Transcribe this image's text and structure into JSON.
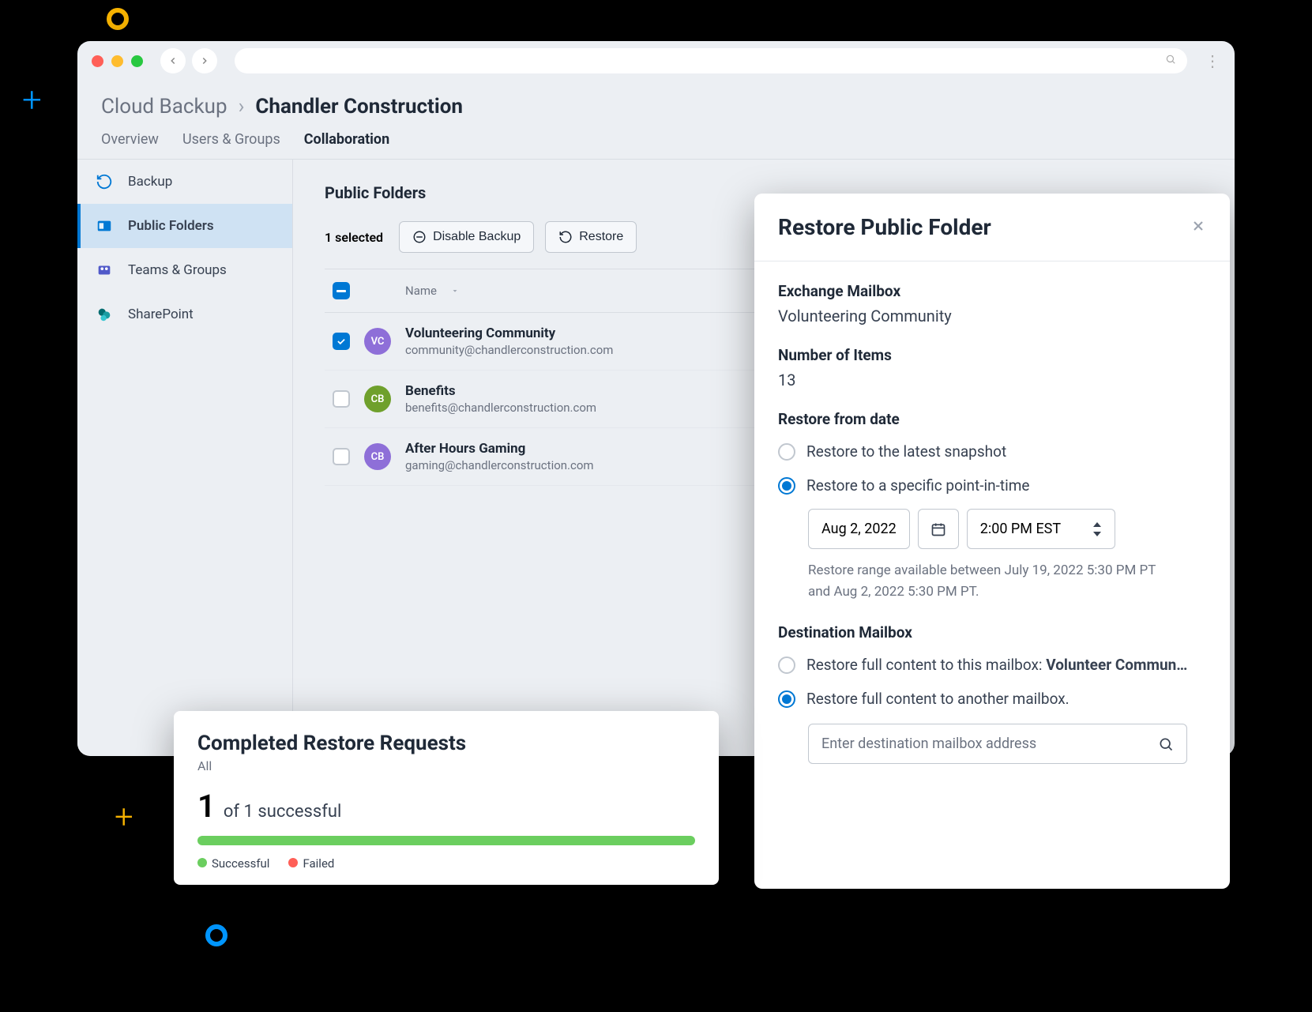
{
  "breadcrumb": {
    "root": "Cloud Backup",
    "current": "Chandler Construction"
  },
  "tabs": [
    "Overview",
    "Users & Groups",
    "Collaboration"
  ],
  "active_tab": "Collaboration",
  "sidebar": {
    "items": [
      {
        "label": "Backup"
      },
      {
        "label": "Public Folders"
      },
      {
        "label": "Teams & Groups"
      },
      {
        "label": "SharePoint"
      }
    ]
  },
  "main": {
    "title": "Public Folders",
    "selected_label": "1 selected",
    "disable_backup_label": "Disable Backup",
    "restore_label": "Restore",
    "name_header": "Name",
    "rows": [
      {
        "initials": "VC",
        "color": "#8e6fd8",
        "name": "Volunteering Community",
        "email": "community@chandlerconstruction.com",
        "checked": true
      },
      {
        "initials": "CB",
        "color": "#6fa02c",
        "name": "Benefits",
        "email": "benefits@chandlerconstruction.com",
        "checked": false
      },
      {
        "initials": "CB",
        "color": "#8e6fd8",
        "name": "After Hours Gaming",
        "email": "gaming@chandlerconstruction.com",
        "checked": false
      }
    ]
  },
  "restore": {
    "title": "Restore Public Folder",
    "mailbox_label": "Exchange Mailbox",
    "mailbox_value": "Volunteering Community",
    "items_label": "Number of Items",
    "items_value": "13",
    "date_section_label": "Restore from date",
    "radio_latest": "Restore to the latest snapshot",
    "radio_point": "Restore to a specific point-in-time",
    "date_value": "Aug 2, 2022",
    "time_value": "2:00 PM EST",
    "helper": "Restore range available between July 19, 2022 5:30 PM PT and Aug 2, 2022 5:30 PM PT.",
    "dest_label": "Destination Mailbox",
    "dest_radio_this_prefix": "Restore full content to this mailbox: ",
    "dest_radio_this_name": "Volunteer Community",
    "dest_radio_other": "Restore full content to another mailbox.",
    "dest_placeholder": "Enter destination mailbox address"
  },
  "completed": {
    "title": "Completed Restore Requests",
    "sub": "All",
    "big": "1",
    "rest": "of 1 successful",
    "legend_success": "Successful",
    "legend_failed": "Failed",
    "colors": {
      "success": "#6bce5f",
      "failed": "#ff5f57"
    }
  }
}
